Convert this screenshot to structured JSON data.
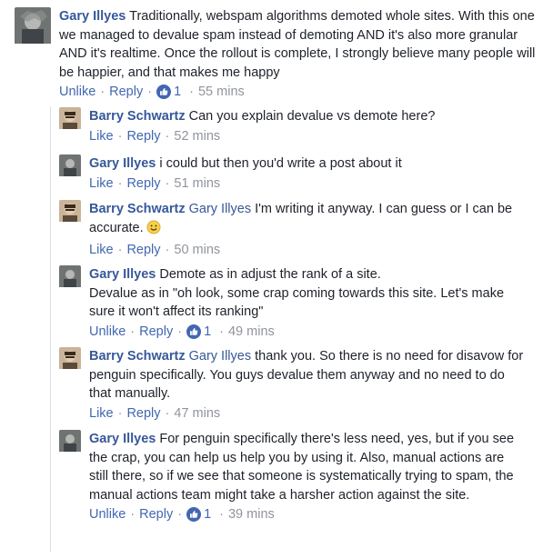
{
  "comments": [
    {
      "author": "Gary Illyes",
      "avatar": "gary-avatar",
      "text": " Traditionally, webspam algorithms demoted whole sites. With this one we managed to devalue spam instead of demoting AND it's also more granular AND it's realtime. Once the rollout is complete, I strongly believe many people will be happier, and that makes me happy",
      "like_label": "Unlike",
      "reply_label": "Reply",
      "likes": "1",
      "time": "55 mins"
    }
  ],
  "replies": [
    {
      "author": "Barry Schwartz",
      "avatar": "barry-avatar",
      "text": " Can you explain devalue vs demote here?",
      "like_label": "Like",
      "reply_label": "Reply",
      "time": "52 mins"
    },
    {
      "author": "Gary Illyes",
      "avatar": "gary-avatar",
      "text": " i could but then you'd write a post about it",
      "like_label": "Like",
      "reply_label": "Reply",
      "time": "51 mins"
    },
    {
      "author": "Barry Schwartz",
      "avatar": "barry-avatar",
      "mention": "Gary Illyes",
      "text": " I'm writing it anyway. I can guess or I can be accurate.",
      "emoji": "smile-emoji",
      "like_label": "Like",
      "reply_label": "Reply",
      "time": "50 mins"
    },
    {
      "author": "Gary Illyes",
      "avatar": "gary-avatar",
      "text": " Demote as in adjust the rank of a site.",
      "text2": "Devalue as in \"oh look, some crap coming towards this site. Let's make sure it won't affect its ranking\"",
      "like_label": "Unlike",
      "reply_label": "Reply",
      "likes": "1",
      "time": "49 mins"
    },
    {
      "author": "Barry Schwartz",
      "avatar": "barry-avatar",
      "mention": "Gary Illyes",
      "text": " thank you. So there is no need for disavow for penguin specifically. You guys devalue them anyway and no need to do that manually.",
      "like_label": "Like",
      "reply_label": "Reply",
      "time": "47 mins"
    },
    {
      "author": "Gary Illyes",
      "avatar": "gary-avatar",
      "text": " For penguin specifically there's less need, yes, but if you see the crap, you can help us help you by using it. Also, manual actions are still there, so if we see that someone is systematically trying to spam, the manual actions team might take a harsher action against the site.",
      "like_label": "Unlike",
      "reply_label": "Reply",
      "likes": "1",
      "time": "39 mins"
    }
  ],
  "colors": {
    "link": "#365899",
    "action": "#4267b2",
    "muted": "#90949c",
    "text": "#1d2129",
    "like_badge": "#4267b2"
  },
  "icons": {
    "like_badge": "thumbs-up-icon"
  }
}
